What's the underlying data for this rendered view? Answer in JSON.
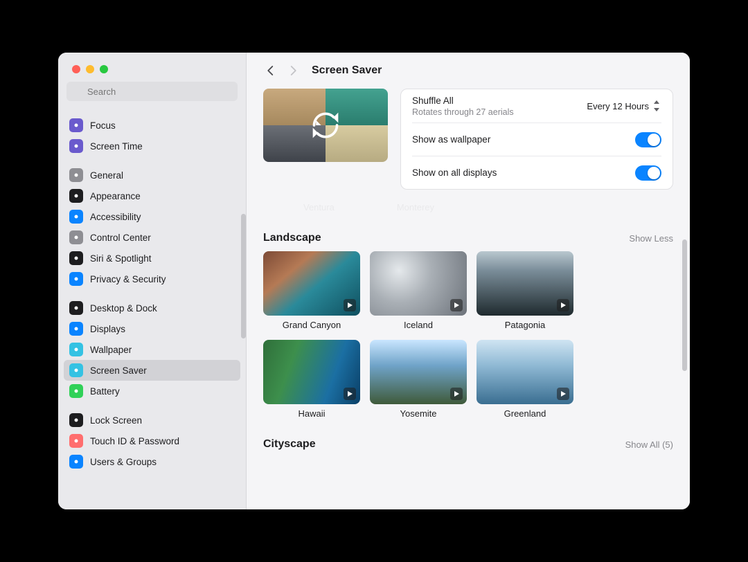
{
  "search": {
    "placeholder": "Search"
  },
  "header": {
    "title": "Screen Saver"
  },
  "sidebar": {
    "groups": [
      {
        "items": [
          {
            "label": "Focus",
            "icon": "moon-icon",
            "color": "#6a5acd"
          },
          {
            "label": "Screen Time",
            "icon": "hourglass-icon",
            "color": "#6a5acd"
          }
        ]
      },
      {
        "items": [
          {
            "label": "General",
            "icon": "gear-icon",
            "color": "#8e8e93"
          },
          {
            "label": "Appearance",
            "icon": "appearance-icon",
            "color": "#1d1d1f"
          },
          {
            "label": "Accessibility",
            "icon": "accessibility-icon",
            "color": "#0a84ff"
          },
          {
            "label": "Control Center",
            "icon": "sliders-icon",
            "color": "#8e8e93"
          },
          {
            "label": "Siri & Spotlight",
            "icon": "siri-icon",
            "color": "#1d1d1f"
          },
          {
            "label": "Privacy & Security",
            "icon": "hand-icon",
            "color": "#0a84ff"
          }
        ]
      },
      {
        "items": [
          {
            "label": "Desktop & Dock",
            "icon": "dock-icon",
            "color": "#1d1d1f"
          },
          {
            "label": "Displays",
            "icon": "displays-icon",
            "color": "#0a84ff"
          },
          {
            "label": "Wallpaper",
            "icon": "wallpaper-icon",
            "color": "#34c2e3"
          },
          {
            "label": "Screen Saver",
            "icon": "screensaver-icon",
            "color": "#34c2e3",
            "selected": true
          },
          {
            "label": "Battery",
            "icon": "battery-icon",
            "color": "#30d158"
          }
        ]
      },
      {
        "items": [
          {
            "label": "Lock Screen",
            "icon": "lock-icon",
            "color": "#1d1d1f"
          },
          {
            "label": "Touch ID & Password",
            "icon": "fingerprint-icon",
            "color": "#ff6e6e"
          },
          {
            "label": "Users & Groups",
            "icon": "users-icon",
            "color": "#0a84ff"
          }
        ]
      }
    ]
  },
  "card": {
    "shuffle_label": "Shuffle All",
    "shuffle_sub": "Rotates through 27 aerials",
    "freq_value": "Every 12 Hours",
    "wallpaper_label": "Show as wallpaper",
    "alldisplays_label": "Show on all displays"
  },
  "peek": {
    "a": "Ventura",
    "b": "Monterey"
  },
  "sections": [
    {
      "title": "Landscape",
      "action": "Show Less",
      "tiles": [
        {
          "label": "Grand Canyon",
          "cls": "tg-canyon"
        },
        {
          "label": "Iceland",
          "cls": "tg-iceland"
        },
        {
          "label": "Patagonia",
          "cls": "tg-patagonia"
        },
        {
          "label": "Hawaii",
          "cls": "tg-hawaii"
        },
        {
          "label": "Yosemite",
          "cls": "tg-yosemite"
        },
        {
          "label": "Greenland",
          "cls": "tg-greenland"
        }
      ]
    },
    {
      "title": "Cityscape",
      "action": "Show All (5)",
      "tiles": []
    }
  ]
}
